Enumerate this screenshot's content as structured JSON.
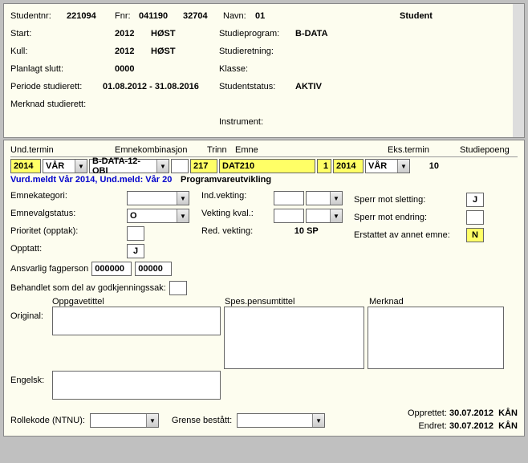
{
  "top": {
    "studentnr_label": "Studentnr:",
    "studentnr": "221094",
    "fnr_label": "Fnr:",
    "fnr1": "041190",
    "fnr2": "32704",
    "navn_label": "Navn:",
    "navn": "01",
    "rolle": "Student",
    "start_label": "Start:",
    "start_year": "2012",
    "start_term": "HØST",
    "studieprogram_label": "Studieprogram:",
    "studieprogram": "B-DATA",
    "kull_label": "Kull:",
    "kull_year": "2012",
    "kull_term": "HØST",
    "studieretning_label": "Studieretning:",
    "planlagt_slutt_label": "Planlagt slutt:",
    "planlagt_slutt": "0000",
    "klasse_label": "Klasse:",
    "periode_label": "Periode studierett:",
    "periode": "01.08.2012 - 31.08.2016",
    "studentstatus_label": "Studentstatus:",
    "studentstatus": "AKTIV",
    "merknad_label": "Merknad studierett:",
    "instrument_label": "Instrument:"
  },
  "headers": {
    "undtermin": "Und.termin",
    "emnekomb": "Emnekombinasjon",
    "trinn": "Trinn",
    "emne": "Emne",
    "ekstermin": "Eks.termin",
    "studiepoeng": "Studiepoeng"
  },
  "record": {
    "year1": "2014",
    "term1": "VÅR",
    "emnekomb": "B-DATA-12-OBI",
    "trinn": "",
    "emne_code": "217",
    "emne_id": "DAT210",
    "seq": "1",
    "year2": "2014",
    "term2": "VÅR",
    "sp": "10",
    "status_text": "Vurd.meldt Vår 2014, Und.meld: Vår 20",
    "emne_name": "Programvareutvikling"
  },
  "form": {
    "emnekategori_label": "Emnekategori:",
    "indvekting_label": "Ind.vekting:",
    "sperr_slett_label": "Sperr mot sletting:",
    "sperr_slett": "J",
    "emnevalgstatus_label": "Emnevalgstatus:",
    "emnevalgstatus": "O",
    "vektingkval_label": "Vekting kval.:",
    "sperr_endr_label": "Sperr mot endring:",
    "prioritet_label": "Prioritet (opptak):",
    "redvekting_label": "Red. vekting:",
    "redvekting_val": "10",
    "redvekting_unit": "SP",
    "erstattet_label": "Erstattet av annet emne:",
    "erstattet": "N",
    "opptatt_label": "Opptatt:",
    "opptatt": "J",
    "ansvarlig_label": "Ansvarlig fagperson",
    "ansvarlig1": "000000",
    "ansvarlig2": "00000",
    "behandlet_label": "Behandlet som del av godkjenningssak:",
    "oppgavetittel": "Oppgavetittel",
    "spespensum": "Spes.pensumtittel",
    "merknad": "Merknad",
    "original": "Original:",
    "engelsk": "Engelsk:",
    "rollekode_label": "Rollekode (NTNU):",
    "grense_label": "Grense bestått:"
  },
  "footer": {
    "opprettet_label": "Opprettet:",
    "opprettet_date": "30.07.2012",
    "opprettet_by": "KÅN",
    "endret_label": "Endret:",
    "endret_date": "30.07.2012",
    "endret_by": "KÅN"
  }
}
